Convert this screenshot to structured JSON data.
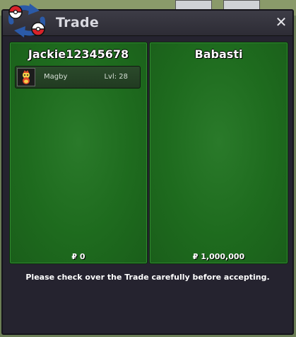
{
  "window": {
    "title": "Trade",
    "close_label": "✕"
  },
  "left_panel": {
    "name": "Jackie12345678",
    "items": [
      {
        "name": "Magby",
        "level": "Lvl: 28",
        "icon": "magby-icon"
      }
    ],
    "money": "₽ 0"
  },
  "right_panel": {
    "name": "Babasti",
    "money": "₽ 1,000,000"
  },
  "footer": {
    "notice": "Please check over the Trade carefully before accepting."
  },
  "colors": {
    "panel_green": "#1e6b1e",
    "window_bg": "#25232f",
    "title_text": "#d9d9e0"
  }
}
